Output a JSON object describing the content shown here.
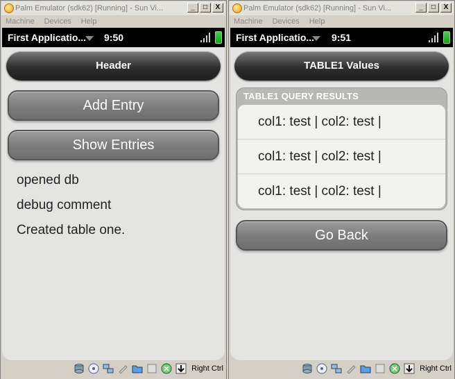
{
  "left_window": {
    "title": "Palm Emulator (sdk62) [Running] - Sun Vi...",
    "menu": [
      "Machine",
      "Devices",
      "Help"
    ],
    "status": {
      "app_menu": "First Applicatio...",
      "time": "9:50"
    },
    "header": "Header",
    "buttons": {
      "add_entry": "Add Entry",
      "show_entries": "Show Entries"
    },
    "log": [
      "opened db",
      "debug comment",
      "Created table one."
    ],
    "host_key": "Right Ctrl"
  },
  "right_window": {
    "title": "Palm Emulator (sdk62) [Running] - Sun Vi...",
    "menu": [
      "Machine",
      "Devices",
      "Help"
    ],
    "status": {
      "app_menu": "First Applicatio...",
      "time": "9:51"
    },
    "header": "TABLE1 Values",
    "results_title": "TABLE1 QUERY RESULTS",
    "rows": [
      "col1: test | col2: test |",
      "col1: test | col2: test |",
      "col1: test | col2: test |"
    ],
    "buttons": {
      "go_back": "Go Back"
    },
    "host_key": "Right Ctrl"
  },
  "titlebar_buttons": [
    "_",
    "□",
    "X"
  ],
  "icons": [
    "hard-disk-icon",
    "optical-drive-icon",
    "network-icon",
    "usb-icon",
    "shared-folders-icon",
    "display-icon",
    "mouse-integration-icon",
    "host-key-arrow-icon"
  ],
  "colors": {
    "header_dark": "#2e2e2e",
    "button_gray": "#7e7e7e",
    "screen_bg": "#e4e4e2",
    "battery_green": "#33cc33"
  }
}
